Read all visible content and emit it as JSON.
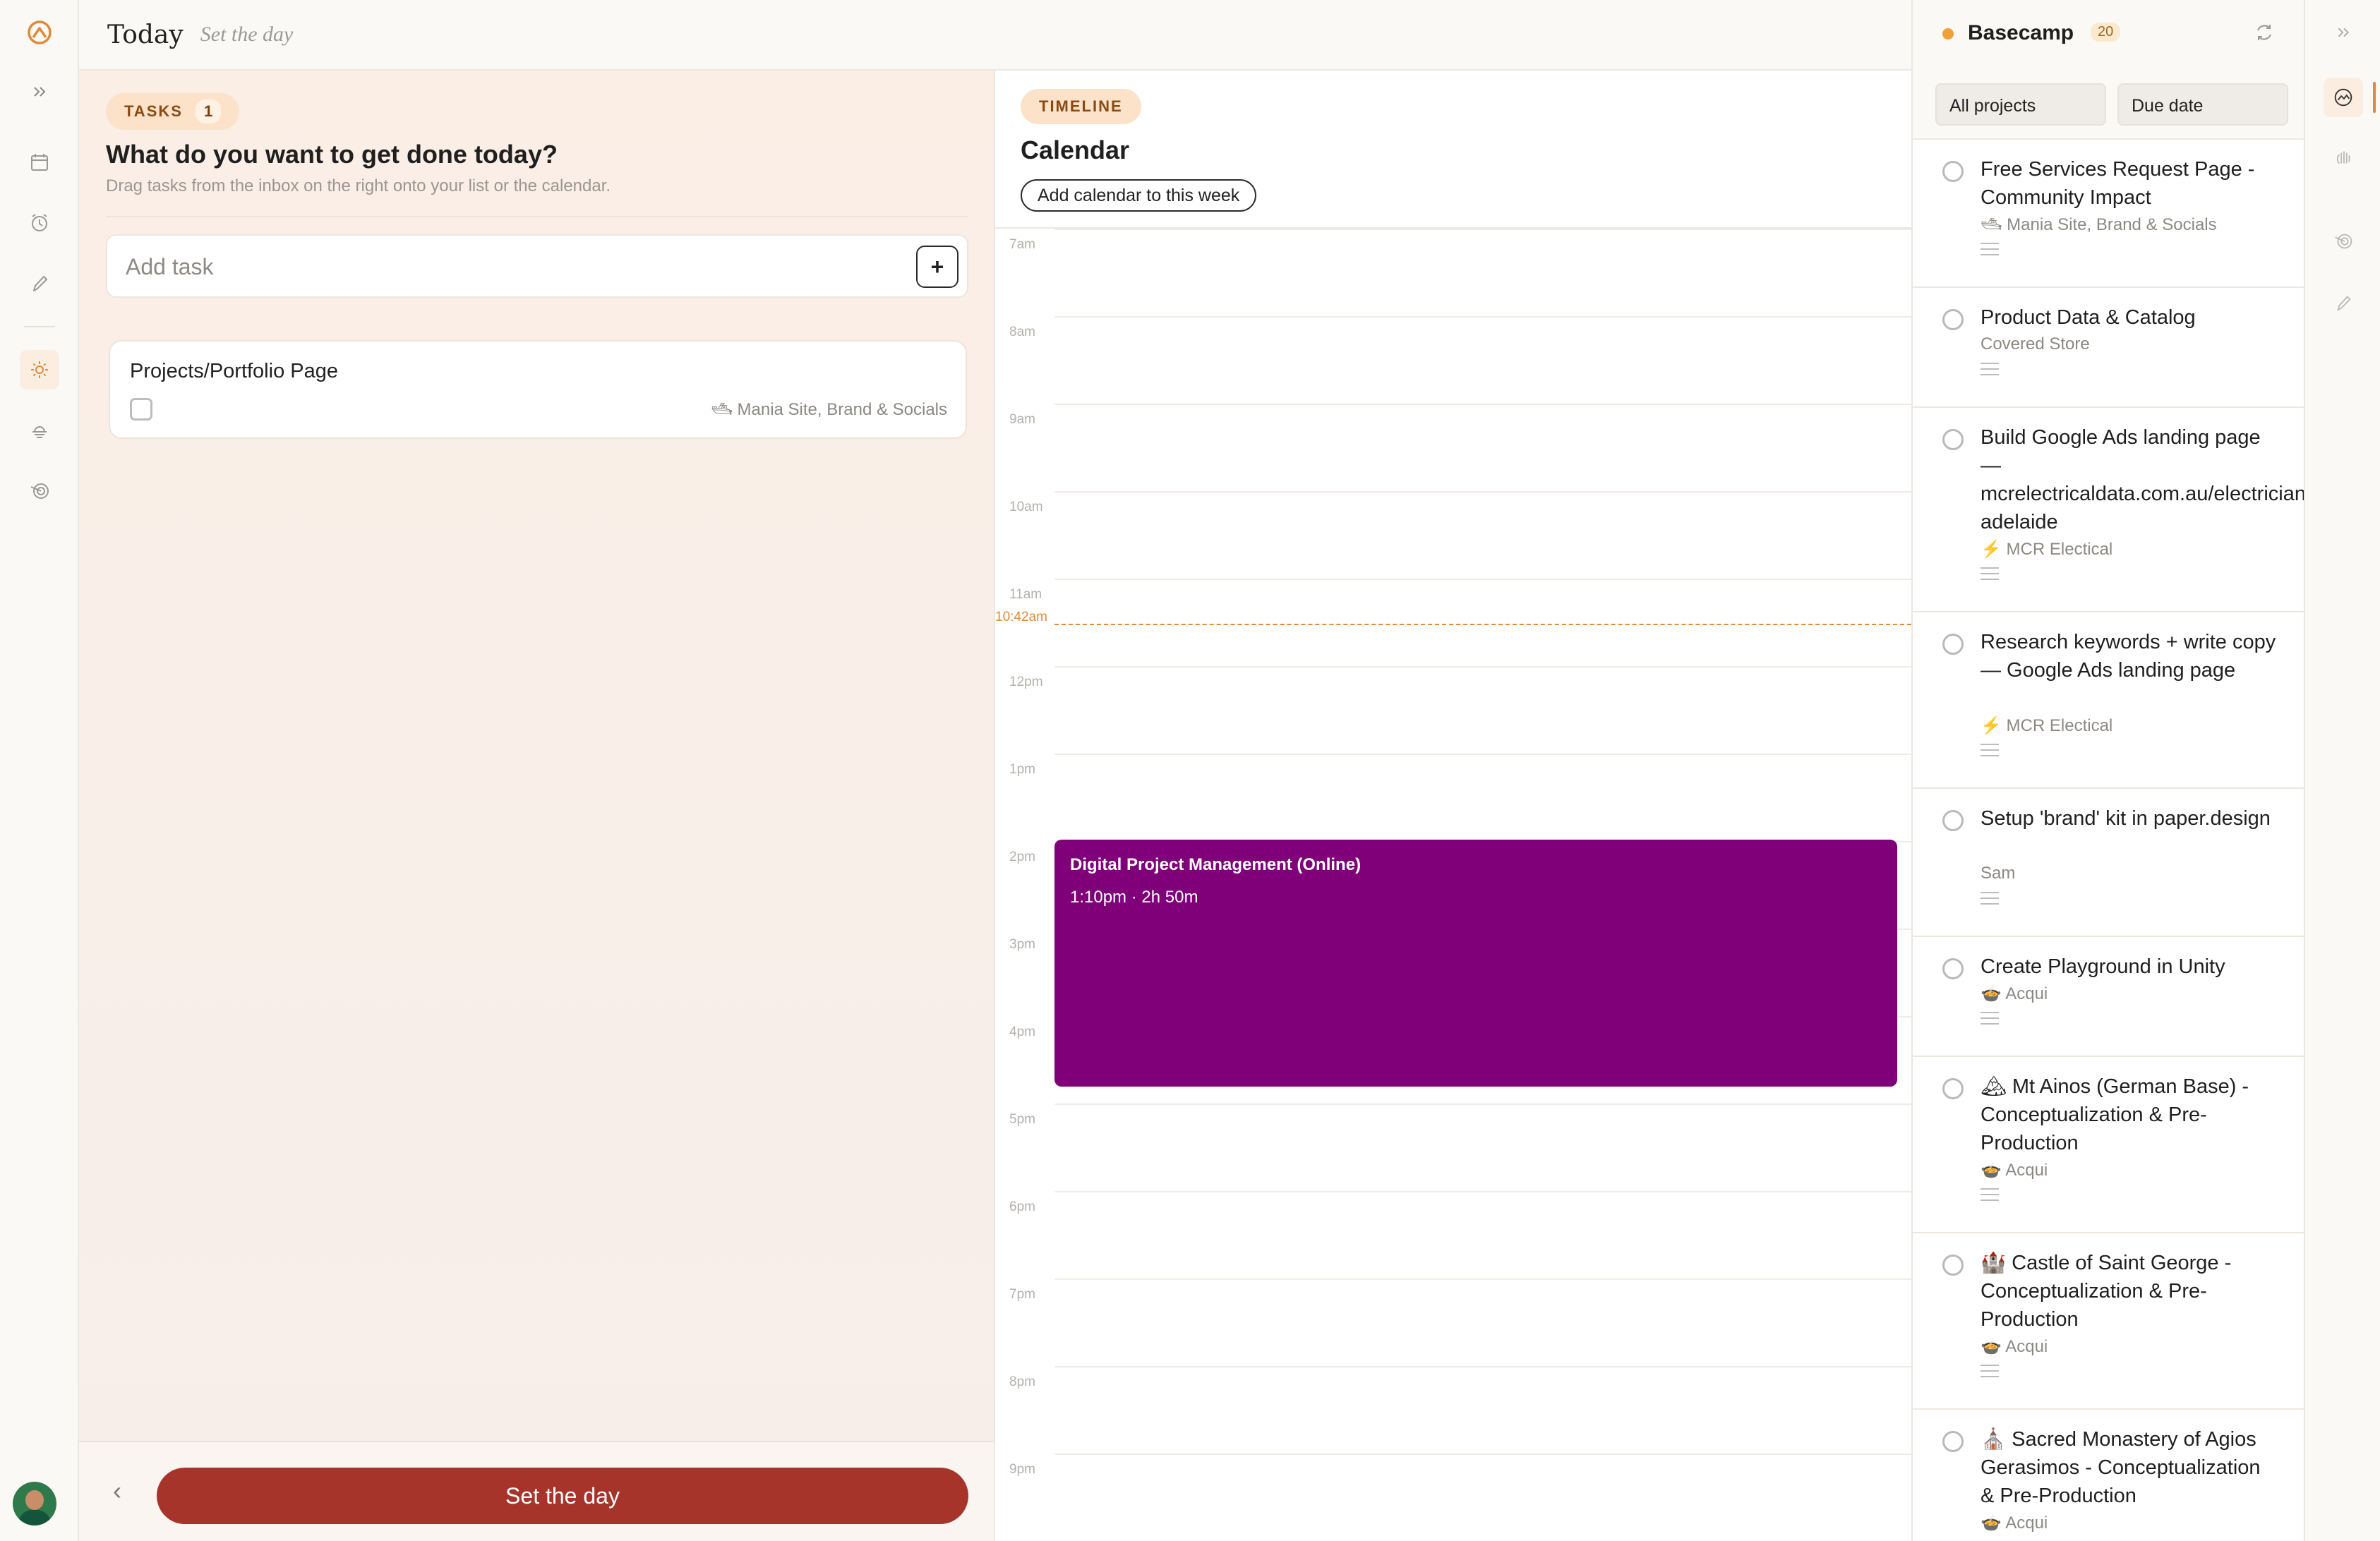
{
  "header": {
    "title": "Today",
    "subtitle": "Set the day"
  },
  "tasks": {
    "pill_label": "TASKS",
    "pill_count": "1",
    "question": "What do you want to get done today?",
    "hint": "Drag tasks from the inbox on the right onto your list or the calendar.",
    "add_placeholder": "Add task",
    "add_button": "+",
    "items": [
      {
        "name": "Projects/Portfolio Page",
        "project": "Mania Site, Brand & Socials",
        "project_icon": "🛥"
      }
    ],
    "back_icon": "‹",
    "cta": "Set the day"
  },
  "timeline": {
    "pill_label": "TIMELINE",
    "heading": "Calendar",
    "add_calendar": "Add calendar to this week",
    "hours": [
      "7am",
      "8am",
      "9am",
      "10am",
      "11am",
      "12pm",
      "1pm",
      "2pm",
      "3pm",
      "4pm",
      "5pm",
      "6pm",
      "7pm",
      "8pm",
      "9pm"
    ],
    "now_label": "10:42am",
    "event": {
      "title": "Digital Project Management (Online)",
      "time": "1:10pm · 2h 50m",
      "color": "#7f0079"
    }
  },
  "inbox": {
    "source": "Basecamp",
    "count": "20",
    "filters": [
      "All projects",
      "Due date"
    ],
    "items": [
      {
        "title": "Free Services Request Page - Community Impact",
        "project": "🛥 Mania Site, Brand & Socials"
      },
      {
        "title": "Product Data & Catalog",
        "project": "Covered Store"
      },
      {
        "title": "Build Google Ads landing page — mcrelectricaldata.com.au/electrician-adelaide",
        "project": "⚡ MCR Electical"
      },
      {
        "title": "Research keywords + write copy — Google Ads landing page",
        "project": "⚡ MCR Electical"
      },
      {
        "title": "Setup 'brand' kit in paper.design",
        "project": "Sam"
      },
      {
        "title": "Create Playground in Unity",
        "project": "🍲 Acqui"
      },
      {
        "title": "🏔 Mt Ainos (German Base) - Conceptualization & Pre-Production",
        "project": "🍲 Acqui"
      },
      {
        "title": "🏰 Castle of Saint George - Conceptualization & Pre-Production",
        "project": "🍲 Acqui"
      },
      {
        "title": "⛪ Sacred Monastery of Agios Gerasimos - Conceptualization & Pre-Production",
        "project": "🍲 Acqui"
      }
    ]
  },
  "colors": {
    "accent": "#e08a3a",
    "cta": "#a7342b",
    "event": "#7f0079"
  }
}
